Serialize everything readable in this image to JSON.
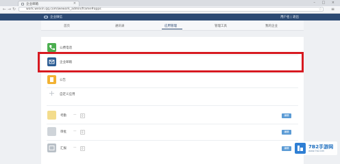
{
  "browser": {
    "tab_title": "企业邮箱",
    "tab_close": "×",
    "window_controls": "– □ ×",
    "url": "work.weixin.qq.com/wework_admin/frame#apps",
    "star": "☆",
    "menu": "≡"
  },
  "app": {
    "brand": "企业微信",
    "user": "用户名 | 退出"
  },
  "nav": {
    "items": [
      {
        "label": "首页"
      },
      {
        "label": "通讯录"
      },
      {
        "label": "应用管理"
      },
      {
        "label": "管理工具"
      },
      {
        "label": "我的企业"
      }
    ],
    "active_index": 2
  },
  "apps": [
    {
      "label": "公费电话",
      "color": "#4caf50",
      "icon": "phone-icon"
    },
    {
      "label": "企业邮箱",
      "color": "#2c5d94",
      "icon": "mail-icon"
    },
    {
      "label": "公告",
      "color": "#f2b233",
      "icon": "announcement-icon"
    },
    {
      "label": "自定义应用",
      "color": "#bfc4ca",
      "icon": "plus-icon"
    }
  ],
  "custom_apps": [
    {
      "label": "考勤",
      "dash": "—",
      "count": "0",
      "button": "编辑",
      "color": "#f3dc8c",
      "icon": "note-icon"
    },
    {
      "label": "审批",
      "dash": "—",
      "count": "0",
      "button": "编辑",
      "color": "#cfd4d9",
      "icon": "document-icon"
    },
    {
      "label": "汇报",
      "dash": "—",
      "count": "0",
      "button": "编辑",
      "color": "#b9c0c7",
      "icon": "report-icon"
    }
  ],
  "watermark": {
    "title": "7B2手游网",
    "subtitle": "www.7b2.net"
  }
}
